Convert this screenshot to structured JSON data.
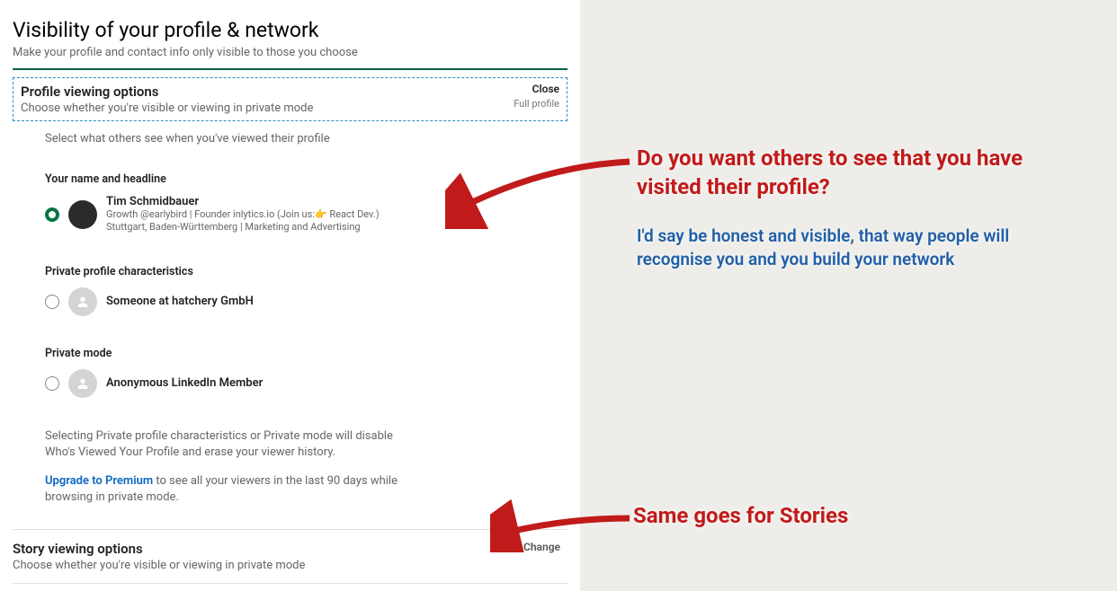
{
  "header": {
    "title": "Visibility of your profile & network",
    "subtitle": "Make your profile and contact info only visible to those you choose"
  },
  "profileViewing": {
    "title": "Profile viewing options",
    "subtitle": "Choose whether you're visible or viewing in private mode",
    "close": "Close",
    "meta": "Full profile",
    "selectText": "Select what others see when you've viewed their profile",
    "option1": {
      "heading": "Your name and headline",
      "name": "Tim Schmidbauer",
      "line1a": "Growth @earlybird | Founder inlytics.io (Join us:",
      "line1b": " React Dev.)",
      "line2": "Stuttgart, Baden-Württemberg | Marketing and Advertising"
    },
    "option2": {
      "heading": "Private profile characteristics",
      "text": "Someone at hatchery GmbH"
    },
    "option3": {
      "heading": "Private mode",
      "text": "Anonymous LinkedIn Member"
    },
    "note": "Selecting Private profile characteristics or Private mode will disable Who's Viewed Your Profile and erase your viewer history.",
    "upgradeLink": "Upgrade to Premium",
    "upgradeText": " to see all your viewers in the last 90 days while browsing in private mode."
  },
  "storyViewing": {
    "title": "Story viewing options",
    "subtitle": "Choose whether you're visible or viewing in private mode",
    "change": "Change"
  },
  "annotations": {
    "question": "Do you want others to see that you have visited their profile?",
    "answer": "I'd say be honest and visible, that way people will recognise you and you build your network",
    "stories": "Same goes for Stories"
  }
}
